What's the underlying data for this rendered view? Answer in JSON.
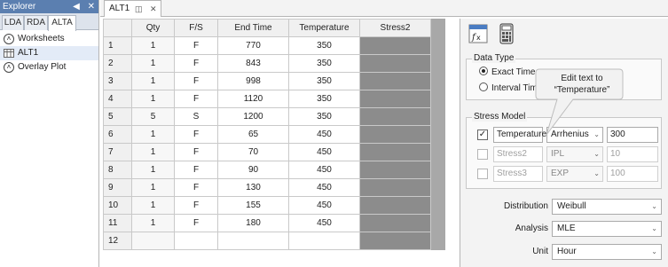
{
  "explorer": {
    "title": "Explorer",
    "tabs": [
      "LDA",
      "RDA",
      "ALTA"
    ],
    "active_tab": "ALTA",
    "tree": [
      {
        "label": "Worksheets",
        "type": "folder"
      },
      {
        "label": "ALT1",
        "type": "sheet"
      },
      {
        "label": "Overlay Plot",
        "type": "folder"
      }
    ]
  },
  "document": {
    "tab_label": "ALT1"
  },
  "grid": {
    "columns": [
      "",
      "Qty",
      "F/S",
      "End Time",
      "Temperature",
      "Stress2"
    ],
    "rows": [
      {
        "n": "1",
        "qty": "1",
        "fs": "F",
        "end": "770",
        "temp": "350"
      },
      {
        "n": "2",
        "qty": "1",
        "fs": "F",
        "end": "843",
        "temp": "350"
      },
      {
        "n": "3",
        "qty": "1",
        "fs": "F",
        "end": "998",
        "temp": "350"
      },
      {
        "n": "4",
        "qty": "1",
        "fs": "F",
        "end": "1120",
        "temp": "350"
      },
      {
        "n": "5",
        "qty": "5",
        "fs": "S",
        "end": "1200",
        "temp": "350"
      },
      {
        "n": "6",
        "qty": "1",
        "fs": "F",
        "end": "65",
        "temp": "450"
      },
      {
        "n": "7",
        "qty": "1",
        "fs": "F",
        "end": "70",
        "temp": "450"
      },
      {
        "n": "8",
        "qty": "1",
        "fs": "F",
        "end": "90",
        "temp": "450"
      },
      {
        "n": "9",
        "qty": "1",
        "fs": "F",
        "end": "130",
        "temp": "450"
      },
      {
        "n": "10",
        "qty": "1",
        "fs": "F",
        "end": "155",
        "temp": "450"
      },
      {
        "n": "11",
        "qty": "1",
        "fs": "F",
        "end": "180",
        "temp": "450"
      },
      {
        "n": "12",
        "qty": "",
        "fs": "",
        "end": "",
        "temp": ""
      }
    ]
  },
  "panel": {
    "data_type": {
      "title": "Data Type",
      "options": [
        "Exact Time",
        "Interval Time"
      ],
      "selected": "Exact Time"
    },
    "stress_model": {
      "title": "Stress Model",
      "rows": [
        {
          "checked": true,
          "name": "Temperature",
          "model": "Arrhenius",
          "value": "300",
          "enabled": true
        },
        {
          "checked": false,
          "name": "Stress2",
          "model": "IPL",
          "value": "10",
          "enabled": false
        },
        {
          "checked": false,
          "name": "Stress3",
          "model": "EXP",
          "value": "100",
          "enabled": false
        }
      ]
    },
    "distribution": {
      "label": "Distribution",
      "value": "Weibull"
    },
    "analysis": {
      "label": "Analysis",
      "value": "MLE"
    },
    "unit": {
      "label": "Unit",
      "value": "Hour"
    }
  },
  "callout": {
    "line1": "Edit text to",
    "line2": "“Temperature”"
  },
  "colors": {
    "explorer_title_bg": "#5b7fb0",
    "stress2_cell": "#8c8c8c"
  }
}
